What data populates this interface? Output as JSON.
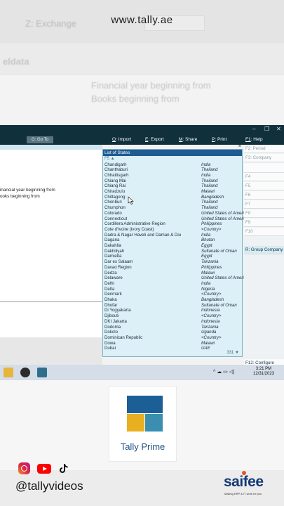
{
  "header": {
    "url": "www.tally.ae",
    "faded_menu_item": "Z: Exchange",
    "faded_section_label": "eldata",
    "faded_fy_label": "Financial year beginning from",
    "faded_books_label": "Books beginning from"
  },
  "window": {
    "controls": [
      "–",
      "❐",
      "✕"
    ]
  },
  "menubar": {
    "goto": "G: Go To",
    "items": [
      {
        "key": "O",
        "label": ": Import"
      },
      {
        "key": "E",
        "label": ": Export"
      },
      {
        "key": "M",
        "label": ": Share"
      },
      {
        "key": "P",
        "label": ": Print"
      },
      {
        "key": "F1",
        "label": ": Help"
      }
    ]
  },
  "company": {
    "fy_label": "inancial year beginning from",
    "books_label": "ooks beginning from"
  },
  "states_list": {
    "title": "List of States",
    "filter_hint": "F5 ▲",
    "close": "×",
    "count": "331 ▼",
    "rows": [
      {
        "name": "Chandigarh",
        "country": "India"
      },
      {
        "name": "Chanthaburi",
        "country": "Thailand"
      },
      {
        "name": "Chhattisgarh",
        "country": "India"
      },
      {
        "name": "Chiang Mai",
        "country": "Thailand"
      },
      {
        "name": "Chiang Rai",
        "country": "Thailand"
      },
      {
        "name": "Chiradzulu",
        "country": "Malawi"
      },
      {
        "name": "Chittagong",
        "country": "Bangladesh"
      },
      {
        "name": "Chonburi",
        "country": "Thailand"
      },
      {
        "name": "Chumphon",
        "country": "Thailand"
      },
      {
        "name": "Colorado",
        "country": "United States of America"
      },
      {
        "name": "Connecticut",
        "country": "United States of America"
      },
      {
        "name": "Cordillera Administrative Region",
        "country": "Philippines"
      },
      {
        "name": "Cote d'Ivoire (Ivory Coast)",
        "country": "<Country>"
      },
      {
        "name": "Dadra & Nagar Haveli and Daman & Diu",
        "country": "India"
      },
      {
        "name": "Dagana",
        "country": "Bhutan"
      },
      {
        "name": "Dakahlia",
        "country": "Egypt"
      },
      {
        "name": "Dakhiliyah",
        "country": "Sultanate of Oman"
      },
      {
        "name": "Damietta",
        "country": "Egypt"
      },
      {
        "name": "Dar es Salaam",
        "country": "Tanzania"
      },
      {
        "name": "Davao Region",
        "country": "Philippines"
      },
      {
        "name": "Dedza",
        "country": "Malawi"
      },
      {
        "name": "Delaware",
        "country": "United States of America"
      },
      {
        "name": "Delhi",
        "country": "India"
      },
      {
        "name": "Delta",
        "country": "Nigeria"
      },
      {
        "name": "Denmark",
        "country": "<Country>"
      },
      {
        "name": "Dhaka",
        "country": "Bangladesh"
      },
      {
        "name": "Dhofar",
        "country": "Sultanate of Oman"
      },
      {
        "name": "Di Yogyakarta",
        "country": "Indonesia"
      },
      {
        "name": "Djibouti",
        "country": "<Country>"
      },
      {
        "name": "DKI Jakarta",
        "country": "Indonesia"
      },
      {
        "name": "Dodoma",
        "country": "Tanzania"
      },
      {
        "name": "Dokolo",
        "country": "Uganda"
      },
      {
        "name": "Dominican Republic",
        "country": "<Country>"
      },
      {
        "name": "Dowa",
        "country": "Malawi"
      },
      {
        "name": "Dubai",
        "country": "UAE"
      }
    ]
  },
  "fkeys": [
    {
      "label": "F2: Period",
      "active": false
    },
    {
      "label": "F3: Company",
      "active": false
    },
    {
      "label": "",
      "active": false
    },
    {
      "label": "F4",
      "active": false
    },
    {
      "label": "F5",
      "active": false
    },
    {
      "label": "F6",
      "active": false
    },
    {
      "label": "F7",
      "active": false
    },
    {
      "label": "F8",
      "active": false
    },
    {
      "label": "F9",
      "active": false
    },
    {
      "label": "F10",
      "active": false
    }
  ],
  "fkey_group": "R: Group Company",
  "fkey_configure": "F12: Configure",
  "taskbar": {
    "time": "3:21 PM",
    "date": "12/31/2023",
    "tray": "^ ☁ ▭ ◁)"
  },
  "logo": {
    "text": "Tally Prime",
    "colors": [
      "#1c5f96",
      "#e8b020",
      "#3a8fb0"
    ]
  },
  "social": {
    "handle": "@tallyvideos",
    "icons": [
      "instagram-icon",
      "youtube-icon",
      "tiktok-icon"
    ]
  },
  "brand": {
    "name": "saifee",
    "tagline": "Making ERP & IT work for you"
  }
}
